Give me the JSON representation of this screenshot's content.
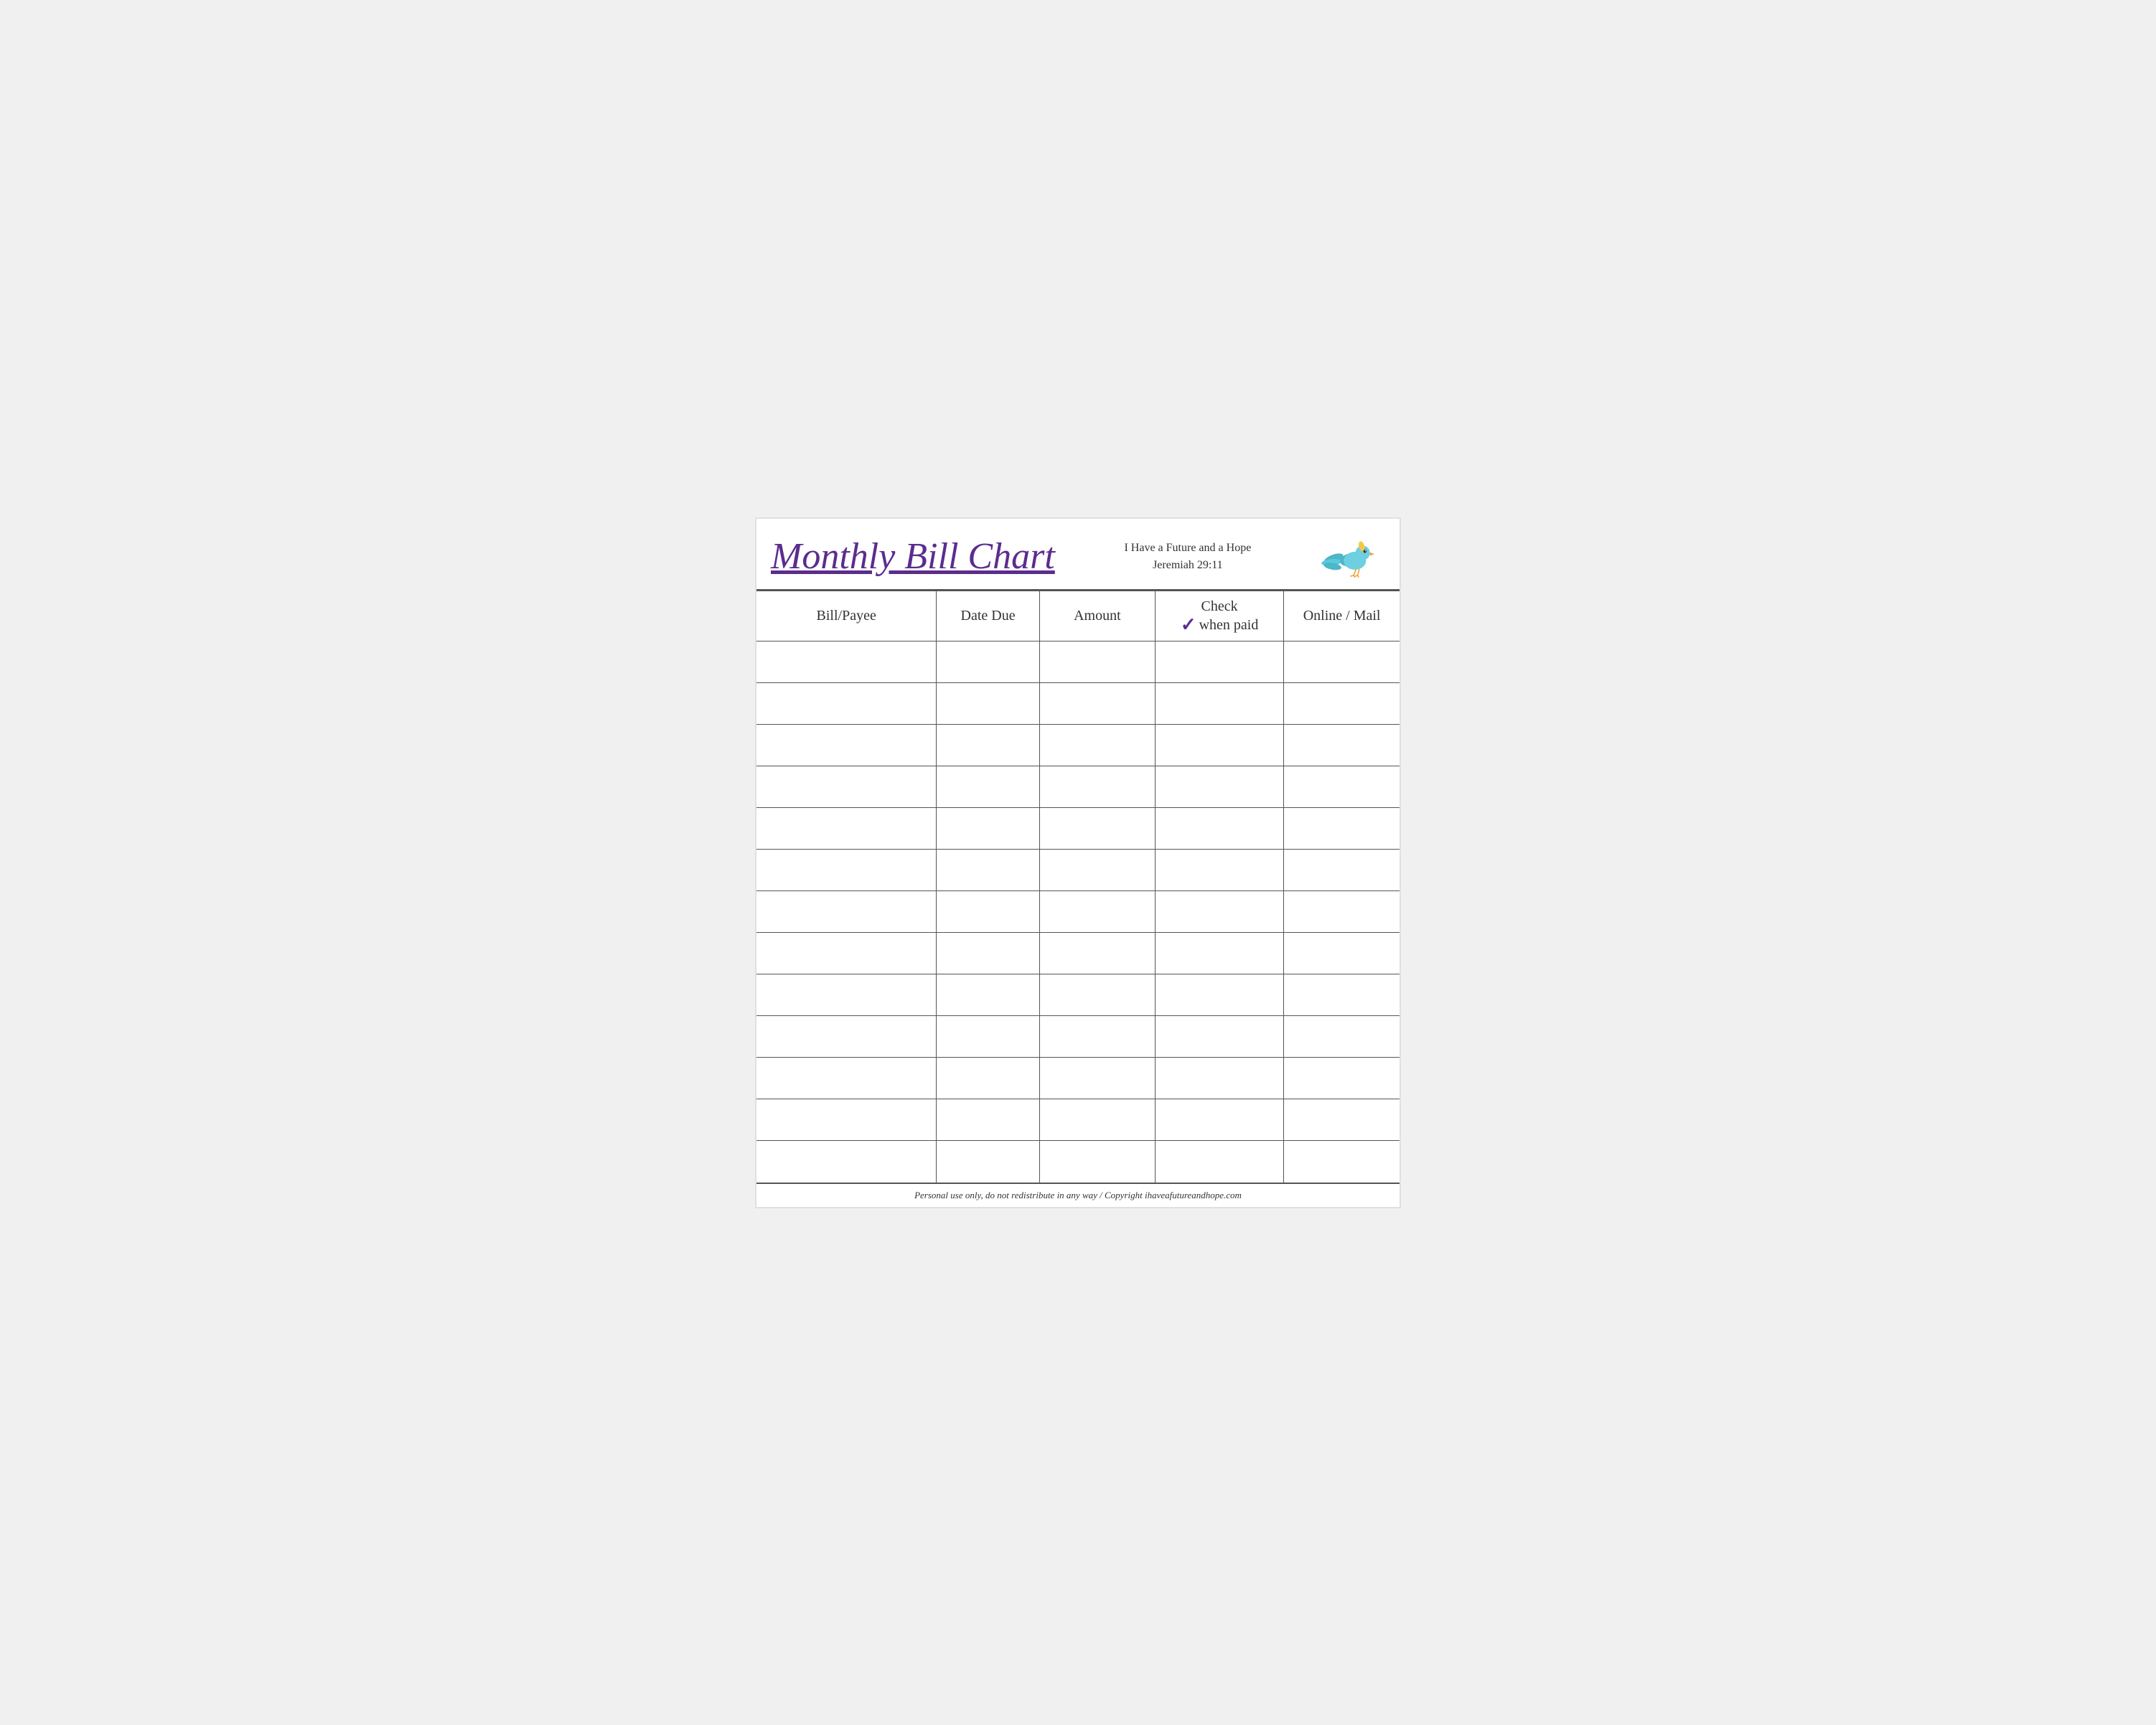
{
  "header": {
    "title": "Monthly Bill Chart",
    "tagline_line1": "I Have a Future and a Hope",
    "tagline_line2": "Jeremiah 29:11"
  },
  "table": {
    "columns": [
      {
        "id": "bill",
        "label": "Bill/Payee"
      },
      {
        "id": "date",
        "label": "Date Due"
      },
      {
        "id": "amount",
        "label": "Amount"
      },
      {
        "id": "check",
        "label_top": "Check",
        "label_bottom": "when paid",
        "has_checkmark": true
      },
      {
        "id": "online",
        "label": "Online / Mail"
      }
    ],
    "row_count": 13
  },
  "footer": {
    "text": "Personal use only, do not redistribute in any way / Copyright ihaveafutureandhope.com"
  }
}
